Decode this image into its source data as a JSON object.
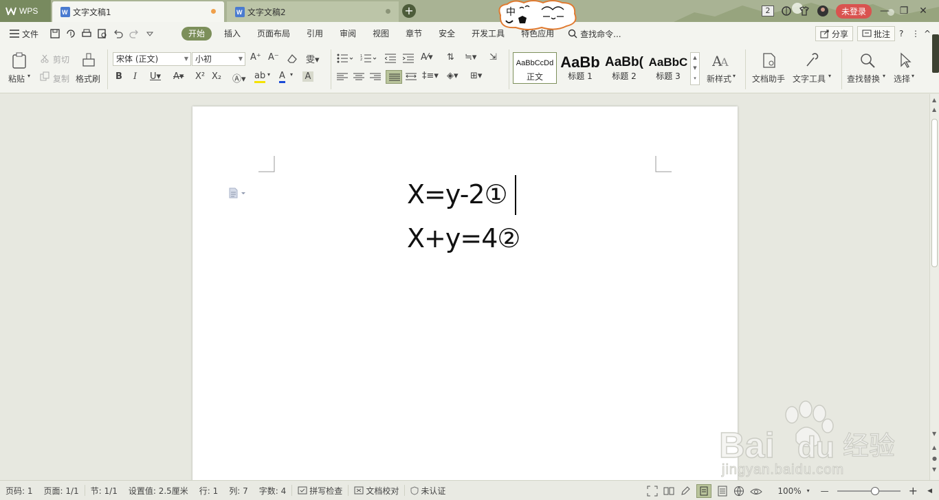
{
  "titlebar": {
    "app_name": "WPS",
    "tabs": [
      {
        "label": "文字文稿1",
        "active": true
      },
      {
        "label": "文字文稿2",
        "active": false
      }
    ],
    "new_tab_symbol": "+",
    "cloud_text": "中",
    "notification_count": "2",
    "login_label": "未登录",
    "window_controls": [
      "—",
      "❐",
      "✕"
    ]
  },
  "menubar": {
    "file_label": "文件",
    "items": [
      "开始",
      "插入",
      "页面布局",
      "引用",
      "审阅",
      "视图",
      "章节",
      "安全",
      "开发工具",
      "特色应用"
    ],
    "active_item": "开始",
    "search_label": "查找命令...",
    "share_label": "分享",
    "comment_label": "批注",
    "help_symbol": "?",
    "more_symbol": "⋮",
    "collapse_symbol": "^"
  },
  "ribbon": {
    "paste_label": "粘贴",
    "cut_label": "剪切",
    "copy_label": "复制",
    "format_painter_label": "格式刷",
    "font_name": "宋体 (正文)",
    "font_size": "小初",
    "style_gallery": [
      {
        "preview": "AaBbCcDd",
        "name": "正文"
      },
      {
        "preview": "AaBb",
        "name": "标题 1"
      },
      {
        "preview": "AaBb(",
        "name": "标题 2"
      },
      {
        "preview": "AaBbC",
        "name": "标题 3"
      }
    ],
    "new_style_label": "新样式",
    "doc_assistant_label": "文档助手",
    "text_tools_label": "文字工具",
    "find_replace_label": "查找替换",
    "select_label": "选择"
  },
  "document": {
    "line1": "X=y-2①",
    "line2": "X+y=4②"
  },
  "statusbar": {
    "page_code": "页码: 1",
    "page_count": "页面: 1/1",
    "section": "节: 1/1",
    "position": "设置值: 2.5厘米",
    "row": "行: 1",
    "column": "列: 7",
    "word_count": "字数: 4",
    "spell_check": "拼写检查",
    "doc_check": "文档校对",
    "auth": "未认证",
    "zoom": "100%",
    "zoom_minus": "—",
    "zoom_plus": "+",
    "zoom_level": 0.6
  },
  "watermark": {
    "brand_left": "Bai",
    "brand_right": "du",
    "brand_cn": "经验",
    "url": "jingyan.baidu.com"
  },
  "colors": {
    "titlebar": "#a9b394",
    "active_menu": "#7c8f5a",
    "login_button": "#d9534f",
    "tab_dot": "#f0a04a"
  }
}
